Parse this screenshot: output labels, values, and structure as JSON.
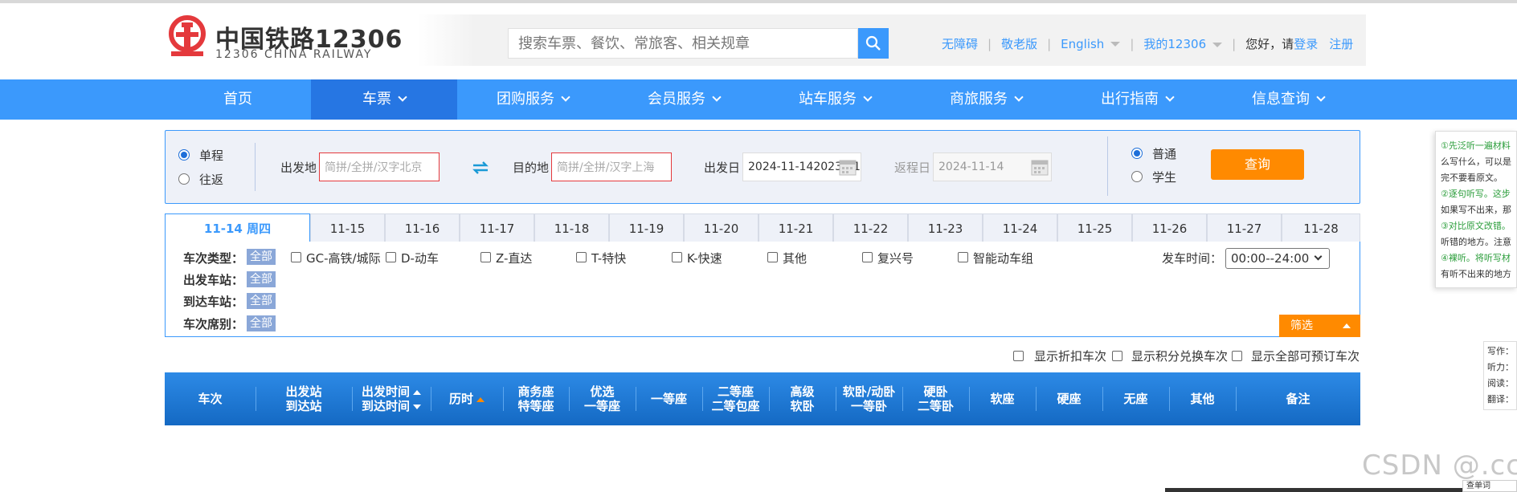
{
  "header": {
    "logo_cn": "中国铁路12306",
    "logo_en": "12306 CHINA RAILWAY",
    "search_placeholder": "搜索车票、餐饮、常旅客、相关规章",
    "links": {
      "accessible": "无障碍",
      "elder": "敬老版",
      "english": "English",
      "my12306": "我的12306",
      "greeting": "您好，请",
      "login": "登录",
      "register": "注册"
    }
  },
  "nav": {
    "items": [
      "首页",
      "车票",
      "团购服务",
      "会员服务",
      "站车服务",
      "商旅服务",
      "出行指南",
      "信息查询"
    ],
    "active_index": 1
  },
  "query": {
    "trip_type": {
      "oneway": "单程",
      "roundtrip": "往返",
      "selected": "单程"
    },
    "from_label": "出发地",
    "from_placeholder": "简拼/全拼/汉字北京",
    "to_label": "目的地",
    "to_placeholder": "简拼/全拼/汉字上海",
    "depart_label": "出发日",
    "depart_value": "2024-11-142023-11-1",
    "return_label": "返程日",
    "return_value": "2024-11-14",
    "ticket_type": {
      "normal": "普通",
      "student": "学生",
      "selected": "普通"
    },
    "search_button": "查询"
  },
  "dates": {
    "active_label": "11-14 周四",
    "items": [
      "11-15",
      "11-16",
      "11-17",
      "11-18",
      "11-19",
      "11-20",
      "11-21",
      "11-22",
      "11-23",
      "11-24",
      "11-25",
      "11-26",
      "11-27",
      "11-28"
    ]
  },
  "filters": {
    "train_type_label": "车次类型：",
    "depart_station_label": "出发车站：",
    "arrive_station_label": "到达车站：",
    "seat_class_label": "车次席别：",
    "all_tag": "全部",
    "train_types": [
      "GC-高铁/城际",
      "D-动车",
      "Z-直达",
      "T-特快",
      "K-快速",
      "其他",
      "复兴号",
      "智能动车组"
    ],
    "time_label": "发车时间：",
    "time_value": "00:00--24:00",
    "screen_button": "筛选"
  },
  "options": [
    "显示折扣车次",
    "显示积分兑换车次",
    "显示全部可预订车次"
  ],
  "result_header": {
    "train_no": "车次",
    "station_from": "出发站",
    "station_to": "到达站",
    "time_from": "出发时间",
    "time_to": "到达时间",
    "duration": "历时",
    "business_1": "商务座",
    "business_2": "特等座",
    "premium_1": "优选",
    "premium_2": "一等座",
    "first": "一等座",
    "second_1": "二等座",
    "second_2": "二等包座",
    "hsoft_1": "高级",
    "hsoft_2": "软卧",
    "soft_sleep_1": "软卧/动卧",
    "soft_sleep_2": "一等卧",
    "hard_sleep_1": "硬卧",
    "hard_sleep_2": "二等卧",
    "soft_seat": "软座",
    "hard_seat": "硬座",
    "no_seat": "无座",
    "other": "其他",
    "remark": "备注"
  },
  "overlay": {
    "notes": [
      "①先泛听一遍材料",
      "么写什么，可以是",
      "完不要看原文。",
      "②逐句听写。这步",
      "如果写不出来，那",
      "③对比原文改错。",
      "听错的地方。注意",
      "④裸听。将听写材",
      "有听不出来的地方"
    ],
    "skills": [
      "写作：",
      "听力：",
      "阅读：",
      "翻译："
    ],
    "bottom_tag": "查单词",
    "watermark": "CSDN @.ccl"
  },
  "colors": {
    "brand_blue": "#3b99fc",
    "nav_active": "#2676e3",
    "orange": "#ff8a00",
    "logo_red": "#e4393c"
  }
}
